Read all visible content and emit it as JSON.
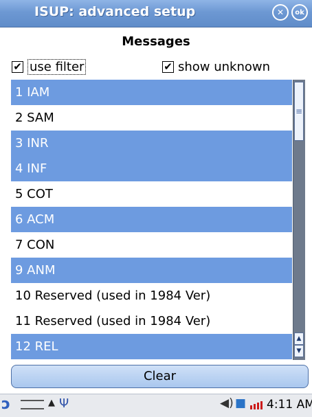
{
  "window": {
    "title": "ISUP: advanced setup",
    "close_icon": "x-circle-icon",
    "ok_label": "ok"
  },
  "messages": {
    "heading": "Messages",
    "use_filter_label": "use filter",
    "use_filter_checked": true,
    "show_unknown_label": "show unknown",
    "show_unknown_checked": true,
    "items": [
      {
        "label": "1 IAM",
        "selected": true
      },
      {
        "label": "2 SAM",
        "selected": false
      },
      {
        "label": "3 INR",
        "selected": true
      },
      {
        "label": "4 INF",
        "selected": true
      },
      {
        "label": "5 COT",
        "selected": false
      },
      {
        "label": "6 ACM",
        "selected": true
      },
      {
        "label": "7 CON",
        "selected": false
      },
      {
        "label": "9 ANM",
        "selected": true
      },
      {
        "label": "10 Reserved (used in 1984 Ver)",
        "selected": false
      },
      {
        "label": "11 Reserved (used in 1984 Ver)",
        "selected": false
      },
      {
        "label": "12 REL",
        "selected": true
      }
    ],
    "clear_label": "Clear"
  },
  "taskbar": {
    "time": "4:11 AM"
  },
  "colors": {
    "selected_row": "#6d9be0",
    "titlebar": "#6d98d3"
  }
}
